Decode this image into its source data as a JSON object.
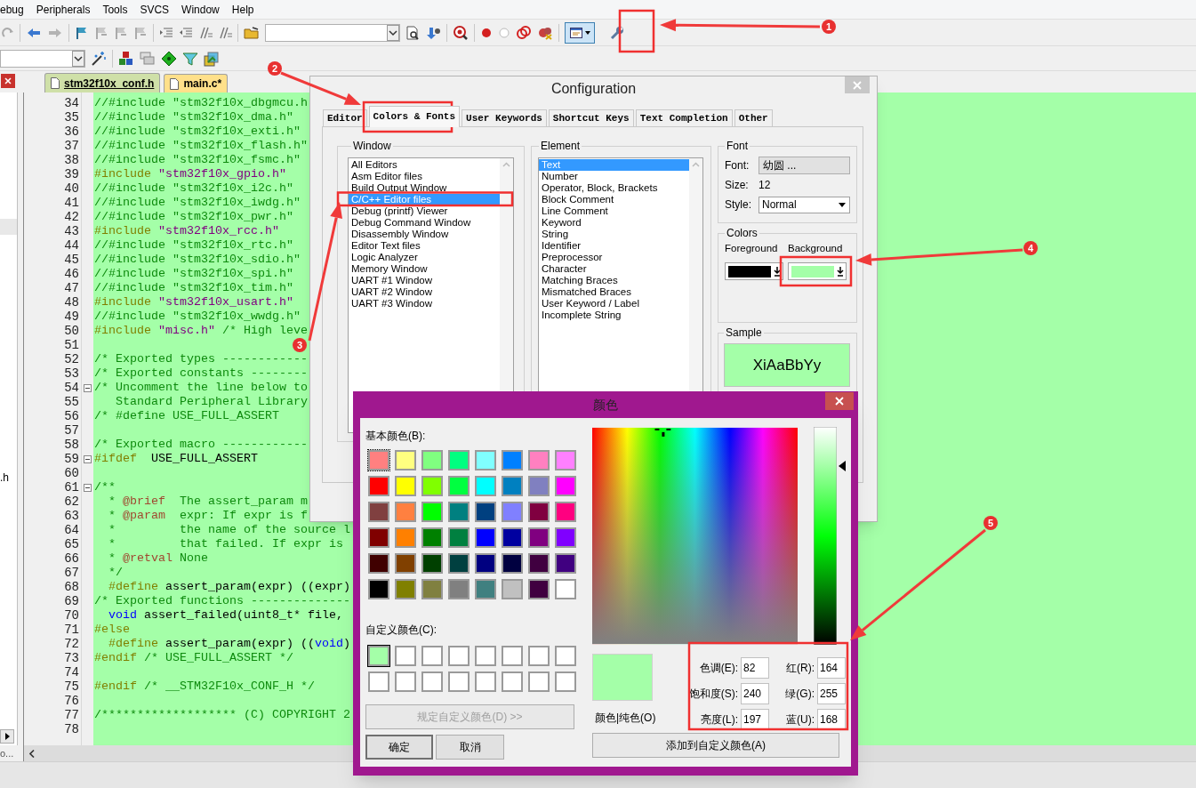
{
  "menu_bar": [
    "ebug",
    "Peripherals",
    "Tools",
    "SVCS",
    "Window",
    "Help"
  ],
  "left_panel": {
    "file_text": ".h",
    "status_text": "o..."
  },
  "editor_tabs": [
    {
      "label": "stm32f10x_conf.h",
      "selected": true
    },
    {
      "label": "main.c*",
      "selected": false
    }
  ],
  "editor": {
    "lines": [
      {
        "number": "34",
        "fold": false,
        "segments": [
          {
            "kind": "comment",
            "text": "//#include \"stm32f10x_dbgmcu.h"
          }
        ]
      },
      {
        "number": "35",
        "fold": false,
        "segments": [
          {
            "kind": "comment",
            "text": "//#include \"stm32f10x_dma.h\""
          }
        ]
      },
      {
        "number": "36",
        "fold": false,
        "segments": [
          {
            "kind": "comment",
            "text": "//#include \"stm32f10x_exti.h\""
          }
        ]
      },
      {
        "number": "37",
        "fold": false,
        "segments": [
          {
            "kind": "comment",
            "text": "//#include \"stm32f10x_flash.h\""
          }
        ]
      },
      {
        "number": "38",
        "fold": false,
        "segments": [
          {
            "kind": "comment",
            "text": "//#include \"stm32f10x_fsmc.h\""
          }
        ]
      },
      {
        "number": "39",
        "fold": false,
        "segments": [
          {
            "kind": "preproc",
            "text": "#include "
          },
          {
            "kind": "string",
            "text": "\"stm32f10x_gpio.h\""
          }
        ]
      },
      {
        "number": "40",
        "fold": false,
        "segments": [
          {
            "kind": "comment",
            "text": "//#include \"stm32f10x_i2c.h\""
          }
        ]
      },
      {
        "number": "41",
        "fold": false,
        "segments": [
          {
            "kind": "comment",
            "text": "//#include \"stm32f10x_iwdg.h\""
          }
        ]
      },
      {
        "number": "42",
        "fold": false,
        "segments": [
          {
            "kind": "comment",
            "text": "//#include \"stm32f10x_pwr.h\""
          }
        ]
      },
      {
        "number": "43",
        "fold": false,
        "segments": [
          {
            "kind": "preproc",
            "text": "#include "
          },
          {
            "kind": "string",
            "text": "\"stm32f10x_rcc.h\""
          }
        ]
      },
      {
        "number": "44",
        "fold": false,
        "segments": [
          {
            "kind": "comment",
            "text": "//#include \"stm32f10x_rtc.h\""
          }
        ]
      },
      {
        "number": "45",
        "fold": false,
        "segments": [
          {
            "kind": "comment",
            "text": "//#include \"stm32f10x_sdio.h\""
          }
        ]
      },
      {
        "number": "46",
        "fold": false,
        "segments": [
          {
            "kind": "comment",
            "text": "//#include \"stm32f10x_spi.h\""
          }
        ]
      },
      {
        "number": "47",
        "fold": false,
        "segments": [
          {
            "kind": "comment",
            "text": "//#include \"stm32f10x_tim.h\""
          }
        ]
      },
      {
        "number": "48",
        "fold": false,
        "segments": [
          {
            "kind": "preproc",
            "text": "#include "
          },
          {
            "kind": "string",
            "text": "\"stm32f10x_usart.h\""
          }
        ]
      },
      {
        "number": "49",
        "fold": false,
        "segments": [
          {
            "kind": "comment",
            "text": "//#include \"stm32f10x_wwdg.h\""
          }
        ]
      },
      {
        "number": "50",
        "fold": false,
        "segments": [
          {
            "kind": "preproc",
            "text": "#include "
          },
          {
            "kind": "string",
            "text": "\"misc.h\""
          },
          {
            "kind": "comment",
            "text": " /* High leve"
          }
        ]
      },
      {
        "number": "51",
        "fold": false
      },
      {
        "number": "52",
        "fold": false,
        "segments": [
          {
            "kind": "comment",
            "text": "/* Exported types ------------"
          }
        ]
      },
      {
        "number": "53",
        "fold": false,
        "segments": [
          {
            "kind": "comment",
            "text": "/* Exported constants --------"
          }
        ]
      },
      {
        "number": "54",
        "fold": true,
        "segments": [
          {
            "kind": "comment",
            "text": "/* Uncomment the line below to"
          }
        ]
      },
      {
        "number": "55",
        "fold": false,
        "segments": [
          {
            "kind": "comment",
            "text": "   Standard Peripheral Library"
          }
        ]
      },
      {
        "number": "56",
        "fold": false,
        "segments": [
          {
            "kind": "comment",
            "text": "/* #define USE_FULL_ASSERT"
          }
        ]
      },
      {
        "number": "57",
        "fold": false
      },
      {
        "number": "58",
        "fold": false,
        "segments": [
          {
            "kind": "comment",
            "text": "/* Exported macro ------------"
          }
        ]
      },
      {
        "number": "59",
        "fold": true,
        "segments": [
          {
            "kind": "preproc",
            "text": "#ifdef"
          },
          {
            "kind": "plain",
            "text": "  USE_FULL_ASSERT"
          }
        ]
      },
      {
        "number": "60",
        "fold": false
      },
      {
        "number": "61",
        "fold": true,
        "segments": [
          {
            "kind": "comment",
            "text": "/**"
          }
        ]
      },
      {
        "number": "62",
        "fold": false,
        "segments": [
          {
            "kind": "comment",
            "text": "  * "
          },
          {
            "kind": "doctag",
            "text": "@brief"
          },
          {
            "kind": "comment",
            "text": "  The assert_param m"
          }
        ]
      },
      {
        "number": "63",
        "fold": false,
        "segments": [
          {
            "kind": "comment",
            "text": "  * "
          },
          {
            "kind": "doctag",
            "text": "@param"
          },
          {
            "kind": "comment",
            "text": "  expr: If expr is f"
          }
        ]
      },
      {
        "number": "64",
        "fold": false,
        "segments": [
          {
            "kind": "comment",
            "text": "  *         the name of the source l"
          }
        ]
      },
      {
        "number": "65",
        "fold": false,
        "segments": [
          {
            "kind": "comment",
            "text": "  *         that failed. If expr is"
          }
        ]
      },
      {
        "number": "66",
        "fold": false,
        "segments": [
          {
            "kind": "comment",
            "text": "  * "
          },
          {
            "kind": "doctag",
            "text": "@retval"
          },
          {
            "kind": "comment",
            "text": " None"
          }
        ]
      },
      {
        "number": "67",
        "fold": false,
        "segments": [
          {
            "kind": "comment",
            "text": "  */"
          }
        ]
      },
      {
        "number": "68",
        "fold": false,
        "segments": [
          {
            "kind": "preproc",
            "text": "  #define"
          },
          {
            "kind": "plain",
            "text": " assert_param(expr) ((expr)"
          }
        ]
      },
      {
        "number": "69",
        "fold": false,
        "segments": [
          {
            "kind": "comment",
            "text": "/* Exported functions --------------"
          }
        ]
      },
      {
        "number": "70",
        "fold": false,
        "segments": [
          {
            "kind": "keyword",
            "text": "  void"
          },
          {
            "kind": "plain",
            "text": " assert_failed(uint8_t* file,"
          }
        ]
      },
      {
        "number": "71",
        "fold": false,
        "segments": [
          {
            "kind": "preproc",
            "text": "#else"
          }
        ]
      },
      {
        "number": "72",
        "fold": false,
        "segments": [
          {
            "kind": "preproc",
            "text": "  #define"
          },
          {
            "kind": "plain",
            "text": " assert_param(expr) (("
          },
          {
            "kind": "keyword",
            "text": "void"
          },
          {
            "kind": "plain",
            "text": ")"
          }
        ]
      },
      {
        "number": "73",
        "fold": false,
        "segments": [
          {
            "kind": "preproc",
            "text": "#endif"
          },
          {
            "kind": "comment",
            "text": " /* USE_FULL_ASSERT */"
          }
        ]
      },
      {
        "number": "74",
        "fold": false
      },
      {
        "number": "75",
        "fold": false,
        "segments": [
          {
            "kind": "preproc",
            "text": "#endif"
          },
          {
            "kind": "comment",
            "text": " /* __STM32F10x_CONF_H */"
          }
        ]
      },
      {
        "number": "76",
        "fold": false
      },
      {
        "number": "77",
        "fold": false,
        "segments": [
          {
            "kind": "comment",
            "text": "/******************* (C) COPYRIGHT 2"
          }
        ]
      },
      {
        "number": "78",
        "fold": false
      }
    ]
  },
  "configuration_dialog": {
    "title": "Configuration",
    "tabs": [
      {
        "label": "Editor",
        "selected": false
      },
      {
        "label": "Colors & Fonts",
        "selected": true
      },
      {
        "label": "User Keywords",
        "selected": false
      },
      {
        "label": "Shortcut Keys",
        "selected": false
      },
      {
        "label": "Text Completion",
        "selected": false
      },
      {
        "label": "Other",
        "selected": false
      }
    ],
    "window_group": {
      "label": "Window",
      "items": [
        {
          "label": "All Editors",
          "selected": false
        },
        {
          "label": "Asm Editor files",
          "selected": false
        },
        {
          "label": "Build Output Window",
          "selected": false
        },
        {
          "label": "C/C++ Editor files",
          "selected": true
        },
        {
          "label": "Debug (printf) Viewer",
          "selected": false
        },
        {
          "label": "Debug Command Window",
          "selected": false
        },
        {
          "label": "Disassembly Window",
          "selected": false
        },
        {
          "label": "Editor Text files",
          "selected": false
        },
        {
          "label": "Logic Analyzer",
          "selected": false
        },
        {
          "label": "Memory Window",
          "selected": false
        },
        {
          "label": "UART #1 Window",
          "selected": false
        },
        {
          "label": "UART #2 Window",
          "selected": false
        },
        {
          "label": "UART #3 Window",
          "selected": false
        }
      ]
    },
    "element_group": {
      "label": "Element",
      "items": [
        {
          "label": "Text",
          "selected": true
        },
        {
          "label": "Number",
          "selected": false
        },
        {
          "label": "Operator, Block, Brackets",
          "selected": false
        },
        {
          "label": "Block Comment",
          "selected": false
        },
        {
          "label": "Line Comment",
          "selected": false
        },
        {
          "label": "Keyword",
          "selected": false
        },
        {
          "label": "String",
          "selected": false
        },
        {
          "label": "Identifier",
          "selected": false
        },
        {
          "label": "Preprocessor",
          "selected": false
        },
        {
          "label": "Character",
          "selected": false
        },
        {
          "label": "Matching Braces",
          "selected": false
        },
        {
          "label": "Mismatched Braces",
          "selected": false
        },
        {
          "label": "User Keyword / Label",
          "selected": false
        },
        {
          "label": "Incomplete String",
          "selected": false
        }
      ]
    },
    "font_group": {
      "label": "Font",
      "font_label": "Font:",
      "font_value": "幼圆 ...",
      "size_label": "Size:",
      "size_value": "12",
      "style_label": "Style:",
      "style_value": "Normal"
    },
    "colors_group": {
      "label": "Colors",
      "swatches": [
        {
          "label": "Foreground",
          "color": "#000000"
        },
        {
          "label": "Background",
          "color": "#a4ffa8"
        }
      ]
    },
    "sample_group": {
      "label": "Sample",
      "text": "XiAaBbYy"
    }
  },
  "color_dialog": {
    "title": "颜色",
    "basic_label": "基本颜色(B):",
    "basic_colors": [
      {
        "color": "#ff8080",
        "selected": true
      },
      {
        "color": "#ffff80",
        "selected": false
      },
      {
        "color": "#80ff80",
        "selected": false
      },
      {
        "color": "#00ff80",
        "selected": false
      },
      {
        "color": "#80ffff",
        "selected": false
      },
      {
        "color": "#0080ff",
        "selected": false
      },
      {
        "color": "#ff80c0",
        "selected": false
      },
      {
        "color": "#ff80ff",
        "selected": false
      },
      {
        "color": "#ff0000",
        "selected": false
      },
      {
        "color": "#ffff00",
        "selected": false
      },
      {
        "color": "#80ff00",
        "selected": false
      },
      {
        "color": "#00ff40",
        "selected": false
      },
      {
        "color": "#00ffff",
        "selected": false
      },
      {
        "color": "#0080c0",
        "selected": false
      },
      {
        "color": "#8080c0",
        "selected": false
      },
      {
        "color": "#ff00ff",
        "selected": false
      },
      {
        "color": "#804040",
        "selected": false
      },
      {
        "color": "#ff8040",
        "selected": false
      },
      {
        "color": "#00ff00",
        "selected": false
      },
      {
        "color": "#008080",
        "selected": false
      },
      {
        "color": "#004080",
        "selected": false
      },
      {
        "color": "#8080ff",
        "selected": false
      },
      {
        "color": "#800040",
        "selected": false
      },
      {
        "color": "#ff0080",
        "selected": false
      },
      {
        "color": "#800000",
        "selected": false
      },
      {
        "color": "#ff8000",
        "selected": false
      },
      {
        "color": "#008000",
        "selected": false
      },
      {
        "color": "#008040",
        "selected": false
      },
      {
        "color": "#0000ff",
        "selected": false
      },
      {
        "color": "#0000a0",
        "selected": false
      },
      {
        "color": "#800080",
        "selected": false
      },
      {
        "color": "#8000ff",
        "selected": false
      },
      {
        "color": "#400000",
        "selected": false
      },
      {
        "color": "#804000",
        "selected": false
      },
      {
        "color": "#004000",
        "selected": false
      },
      {
        "color": "#004040",
        "selected": false
      },
      {
        "color": "#000080",
        "selected": false
      },
      {
        "color": "#000040",
        "selected": false
      },
      {
        "color": "#400040",
        "selected": false
      },
      {
        "color": "#400080",
        "selected": false
      },
      {
        "color": "#000000",
        "selected": false
      },
      {
        "color": "#808000",
        "selected": false
      },
      {
        "color": "#808040",
        "selected": false
      },
      {
        "color": "#808080",
        "selected": false
      },
      {
        "color": "#408080",
        "selected": false
      },
      {
        "color": "#c0c0c0",
        "selected": false
      },
      {
        "color": "#400040",
        "selected": false
      },
      {
        "color": "#ffffff",
        "selected": false
      }
    ],
    "custom_label": "自定义颜色(C):",
    "custom_colors": [
      {
        "color": "#a4ffa8",
        "selected": true
      },
      {
        "color": "#ffffff",
        "selected": false
      },
      {
        "color": "#ffffff",
        "selected": false
      },
      {
        "color": "#ffffff",
        "selected": false
      },
      {
        "color": "#ffffff",
        "selected": false
      },
      {
        "color": "#ffffff",
        "selected": false
      },
      {
        "color": "#ffffff",
        "selected": false
      },
      {
        "color": "#ffffff",
        "selected": false
      },
      {
        "color": "#ffffff",
        "selected": false
      },
      {
        "color": "#ffffff",
        "selected": false
      },
      {
        "color": "#ffffff",
        "selected": false
      },
      {
        "color": "#ffffff",
        "selected": false
      },
      {
        "color": "#ffffff",
        "selected": false
      },
      {
        "color": "#ffffff",
        "selected": false
      },
      {
        "color": "#ffffff",
        "selected": false
      },
      {
        "color": "#ffffff",
        "selected": false
      }
    ],
    "define_button": {
      "label": "规定自定义颜色(D) >>",
      "disabled": true
    },
    "ok_button": "确定",
    "cancel_button": "取消",
    "preview_label": "颜色|纯色(O)",
    "fields": [
      {
        "label": "色调(E):",
        "value": "82"
      },
      {
        "label": "红(R):",
        "value": "164"
      },
      {
        "label": "饱和度(S):",
        "value": "240"
      },
      {
        "label": "绿(G):",
        "value": "255"
      },
      {
        "label": "亮度(L):",
        "value": "197"
      },
      {
        "label": "蓝(U):",
        "value": "168"
      }
    ],
    "add_button": "添加到自定义颜色(A)"
  },
  "annotations": [
    {
      "number": "1"
    },
    {
      "number": "2"
    },
    {
      "number": "3"
    },
    {
      "number": "4"
    },
    {
      "number": "5"
    }
  ]
}
